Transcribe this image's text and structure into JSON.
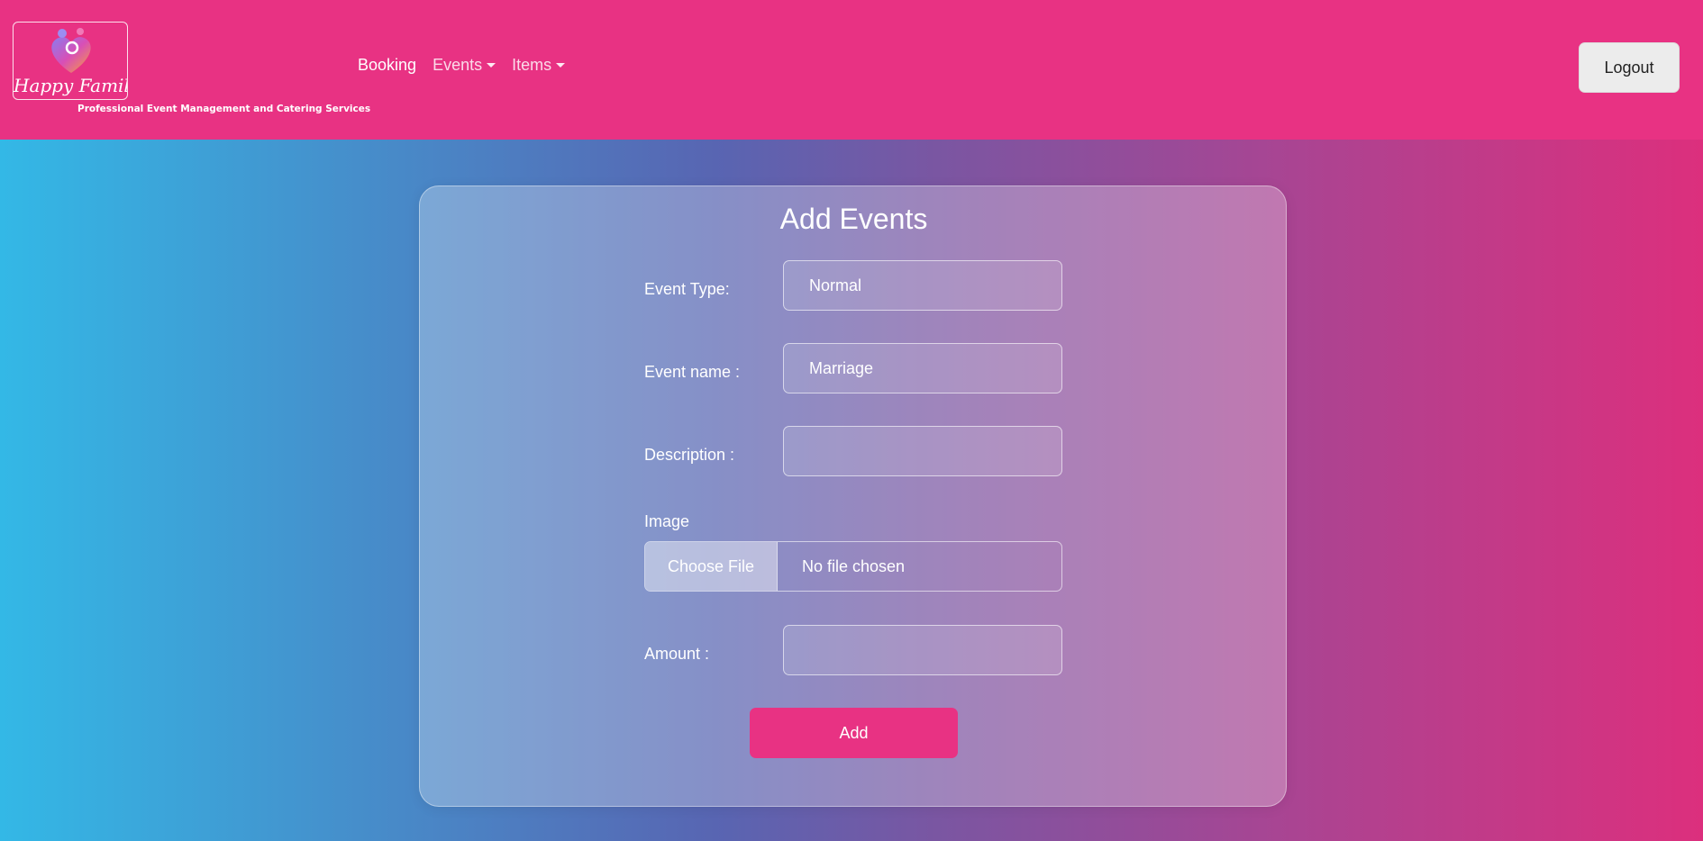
{
  "brand": {
    "logo_text": "Happy Family",
    "tagline": "Professional Event Management and Catering Services"
  },
  "nav": {
    "booking": "Booking",
    "events": "Events",
    "items": "Items",
    "logout": "Logout"
  },
  "form": {
    "title": "Add Events",
    "event_type_label": "Event Type:",
    "event_type_value": "Normal",
    "event_name_label": "Event name :",
    "event_name_value": "Marriage",
    "description_label": "Description :",
    "description_value": "",
    "image_label": "Image",
    "choose_file": "Choose File",
    "file_status": "No file chosen",
    "amount_label": "Amount :",
    "amount_value": "",
    "add_button": "Add"
  },
  "colors": {
    "navbar": "#e83283",
    "accent_button": "#e83283"
  }
}
